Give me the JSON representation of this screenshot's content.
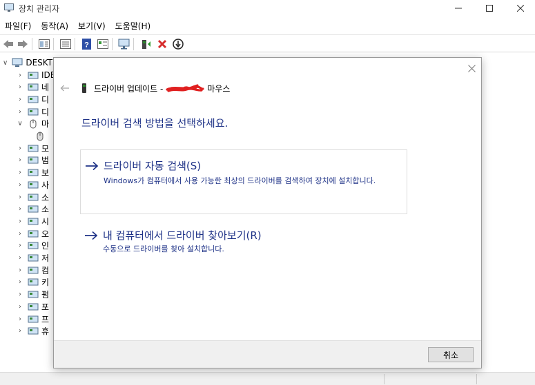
{
  "window": {
    "title": "장치 관리자"
  },
  "menu": [
    "파일(F)",
    "동작(A)",
    "보기(V)",
    "도움말(H)"
  ],
  "toolbar": {
    "icons": [
      "back-arrow-icon",
      "forward-arrow-icon",
      "properties-icon",
      "list-view-icon",
      "help-icon",
      "details-icon",
      "monitor-scan-icon",
      "update-driver-icon",
      "uninstall-x-icon",
      "disable-device-icon"
    ]
  },
  "tree": {
    "root_label": "DESKT",
    "items": [
      {
        "label": "IDE",
        "expanded": false,
        "icon": "ide-controller-icon"
      },
      {
        "label": "네",
        "expanded": false,
        "icon": "network-adapter-icon"
      },
      {
        "label": "디",
        "expanded": false,
        "icon": "disk-drive-icon"
      },
      {
        "label": "디",
        "expanded": false,
        "icon": "display-adapter-icon"
      },
      {
        "label": "마",
        "expanded": true,
        "icon": "mouse-icon"
      },
      {
        "label": "",
        "expanded": null,
        "icon": "mouse-device-icon"
      },
      {
        "label": "모",
        "expanded": false,
        "icon": "monitor-icon"
      },
      {
        "label": "범",
        "expanded": false,
        "icon": "usb-controller-icon"
      },
      {
        "label": "보",
        "expanded": false,
        "icon": "security-device-icon"
      },
      {
        "label": "사",
        "expanded": false,
        "icon": "audio-io-icon"
      },
      {
        "label": "소",
        "expanded": false,
        "icon": "software-component-icon"
      },
      {
        "label": "소",
        "expanded": false,
        "icon": "software-device-icon"
      },
      {
        "label": "시",
        "expanded": false,
        "icon": "system-device-icon"
      },
      {
        "label": "오",
        "expanded": false,
        "icon": "sound-controller-icon"
      },
      {
        "label": "인",
        "expanded": false,
        "icon": "print-queue-icon"
      },
      {
        "label": "저",
        "expanded": false,
        "icon": "storage-controller-icon"
      },
      {
        "label": "컴",
        "expanded": false,
        "icon": "computer-icon"
      },
      {
        "label": "키",
        "expanded": false,
        "icon": "keyboard-icon"
      },
      {
        "label": "펌",
        "expanded": false,
        "icon": "firmware-icon"
      },
      {
        "label": "포",
        "expanded": false,
        "icon": "port-icon"
      },
      {
        "label": "프",
        "expanded": false,
        "icon": "processor-icon"
      },
      {
        "label": "휴",
        "expanded": false,
        "icon": "hid-icon"
      }
    ]
  },
  "dialog": {
    "title_prefix": "드라이버 업데이트 -",
    "title_suffix": "마우스",
    "heading": "드라이버 검색 방법을 선택하세요.",
    "option_auto": {
      "title": "드라이버 자동 검색(S)",
      "desc": "Windows가 컴퓨터에서 사용 가능한 최상의 드라이버를 검색하여 장치에 설치합니다."
    },
    "option_browse": {
      "title": "내 컴퓨터에서 드라이버 찾아보기(R)",
      "desc": "수동으로 드라이버를 찾아 설치합니다."
    },
    "cancel_label": "취소"
  },
  "colors": {
    "link_blue": "#1e3287",
    "redaction_red": "#e02020",
    "uninstall_red": "#d62b2b"
  }
}
